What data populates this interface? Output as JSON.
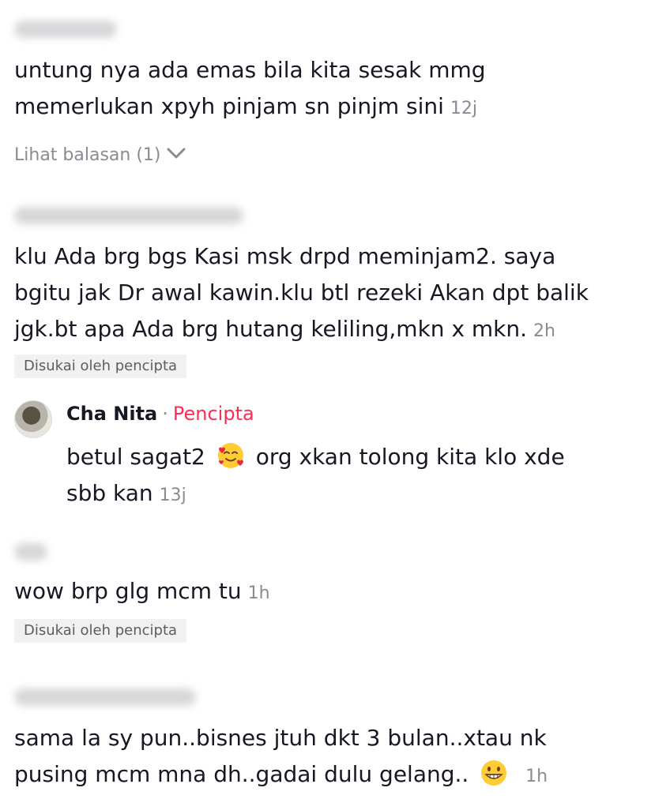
{
  "comments": [
    {
      "lines": [
        "untung nya ada emas bila kita sesak mmg",
        "memerlukan xpyh pinjam sn pinjm sini"
      ],
      "time": "12j",
      "view_replies": "Lihat balasan (1)"
    },
    {
      "lines": [
        "klu Ada brg bgs Kasi msk drpd meminjam2. saya",
        "bgitu jak Dr awal kawin.klu btl rezeki Akan dpt balik",
        "jgk.bt apa Ada brg hutang keliling,mkn x mkn."
      ],
      "time": "2h",
      "badge": "Disukai oleh pencipta",
      "reply": {
        "name": "Cha Nita",
        "dot": "·",
        "role": "Pencipta",
        "line1_before": "betul sagat2",
        "line1_after": "org xkan tolong kita klo xde",
        "line2": "sbb kan",
        "time": "13j",
        "emoji": "smiling-face-with-hearts"
      }
    },
    {
      "lines": [
        "wow brp glg mcm tu"
      ],
      "time": "1h",
      "badge": "Disukai oleh pencipta"
    },
    {
      "lines": [
        "sama la sy pun..bisnes jtuh dkt 3 bulan..xtau nk",
        "pusing mcm mna dh..gadai dulu gelang.."
      ],
      "time": "1h",
      "emoji": "grinning-face"
    }
  ],
  "icons": {
    "chevron": "chevron-down-icon"
  },
  "colors": {
    "creator": "#fe2c55",
    "muted": "#8a8b91",
    "text": "#161823"
  }
}
